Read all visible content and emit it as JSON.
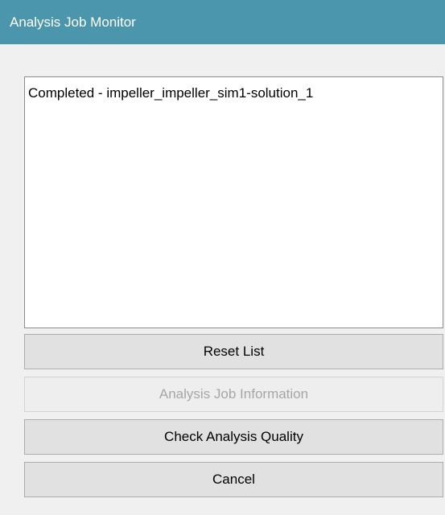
{
  "window": {
    "title": "Analysis Job Monitor"
  },
  "job_list": {
    "items": [
      "Completed - impeller_impeller_sim1-solution_1"
    ]
  },
  "buttons": {
    "reset_list": "Reset List",
    "job_information": "Analysis Job Information",
    "check_quality": "Check Analysis Quality",
    "cancel": "Cancel"
  },
  "colors": {
    "titlebar": "#4b96ad",
    "background": "#f0f0f0",
    "disabled_text": "#a6a6a6"
  }
}
